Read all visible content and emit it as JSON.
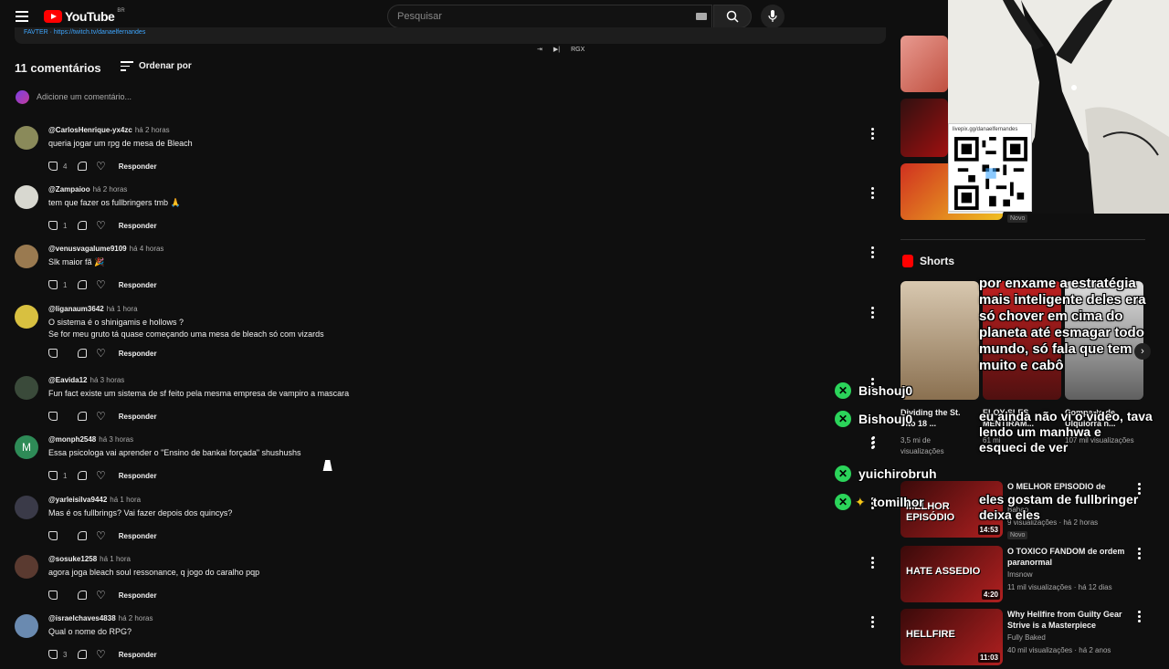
{
  "header": {
    "logo_text": "YouTube",
    "region": "BR",
    "search_placeholder": "Pesquisar"
  },
  "description_strip": "FAVTER · https://twitch.tv/danaelfernandes",
  "player_controls": {
    "label": "RGX"
  },
  "comments": {
    "count_label": "11 comentários",
    "sort_label": "Ordenar por",
    "add_placeholder": "Adicione um comentário...",
    "reply_label": "Responder",
    "items": [
      {
        "author": "@CarlosHenrique-yx4zc",
        "time": "há 2 horas",
        "text": "queria jogar um rpg de mesa de Bleach",
        "likes": "4",
        "avatar_color": "#8a8a5a",
        "avatar_letter": ""
      },
      {
        "author": "@Zampaioo",
        "time": "há 2 horas",
        "text": "tem que fazer os fullbringers tmb 🙏",
        "likes": "1",
        "avatar_color": "#d8d8d0",
        "avatar_letter": ""
      },
      {
        "author": "@venusvagalume9109",
        "time": "há 4 horas",
        "text": "Slk maior fã 🎉",
        "likes": "1",
        "avatar_color": "#9a7a50",
        "avatar_letter": ""
      },
      {
        "author": "@liganaum3642",
        "time": "há 1 hora",
        "text": "O sistema é o shinigamis e hollows ?\nSe for meu gruto tá quase começando uma mesa de bleach só com vizards",
        "likes": "",
        "avatar_color": "#d8c040",
        "avatar_letter": ""
      },
      {
        "author": "@Eavida12",
        "time": "há 3 horas",
        "text": "Fun fact existe um sistema de sf feito pela mesma empresa de vampiro a mascara",
        "likes": "",
        "avatar_color": "#3a4a3a",
        "avatar_letter": ""
      },
      {
        "author": "@monph2548",
        "time": "há 3 horas",
        "text": "Essa psicologa vai aprender o \"Ensino de bankai forçada\" shushushs",
        "likes": "1",
        "avatar_color": "#2e8b57",
        "avatar_letter": "M"
      },
      {
        "author": "@yarleisilva9442",
        "time": "há 1 hora",
        "text": "Mas é os fullbrings? Vai fazer depois dos quincys?",
        "likes": "",
        "avatar_color": "#3a3a48",
        "avatar_letter": ""
      },
      {
        "author": "@sosuke1258",
        "time": "há 1 hora",
        "text": "agora joga bleach soul ressonance, q jogo do caralho pqp",
        "likes": "",
        "avatar_color": "#5a3a30",
        "avatar_letter": ""
      },
      {
        "author": "@israelchaves4838",
        "time": "há 2 horas",
        "text": "Qual o nome do RPG?",
        "likes": "3",
        "avatar_color": "#6a8ab0",
        "avatar_letter": ""
      }
    ]
  },
  "rail": {
    "top_badge": "Novo",
    "shorts_label": "Shorts",
    "shorts": [
      {
        "title": "Dividing the St. into 18 ...",
        "views": "3,5 mi de visualizações"
      },
      {
        "title": "ELOY SLES MENTIRAM...",
        "views": "61 mi"
      },
      {
        "title": "Compartc de Ulquiorra n...",
        "views": "107 mil visualizações"
      }
    ],
    "videos": [
      {
        "title": "O MELHOR EPISODIO de",
        "channel": "Bahao",
        "meta": "9 visualizações · há 2 horas",
        "badge": "Novo",
        "duration": "14:53",
        "thumb_text": "MELHOR EPISÓDIO"
      },
      {
        "title": "O TOXICO FANDOM de ordem paranormal",
        "channel": "Imsnow",
        "meta": "11 mil visualizações · há 12 dias",
        "badge": "",
        "duration": "4:20",
        "thumb_text": "HATE ASSEDIO"
      },
      {
        "title": "Why Hellfire from Guilty Gear Strive is a Masterpiece",
        "channel": "Fully Baked",
        "meta": "40 mil visualizações · há 2 anos",
        "badge": "",
        "duration": "11:03",
        "thumb_text": "HELLFIRE"
      }
    ]
  },
  "overlay": {
    "qr_url": "livepix.gg/danaelfernandes",
    "msg1": "por enxame a estratégia\nmais inteligente deles era\nsó chover em cima do\nplaneta até esmagar todo\nmundo, só fala que tem\nmuito e cabô",
    "msg2": "eu ainda não vi o video, tava\nlendo um manhwa e\nesqueci de ver",
    "msg3": "eles gostam de fullbringer\ndeixa eles",
    "chat_users": [
      "Bishouj0",
      "Bishouj0",
      "yuichirobruh",
      "tomilhor"
    ]
  }
}
